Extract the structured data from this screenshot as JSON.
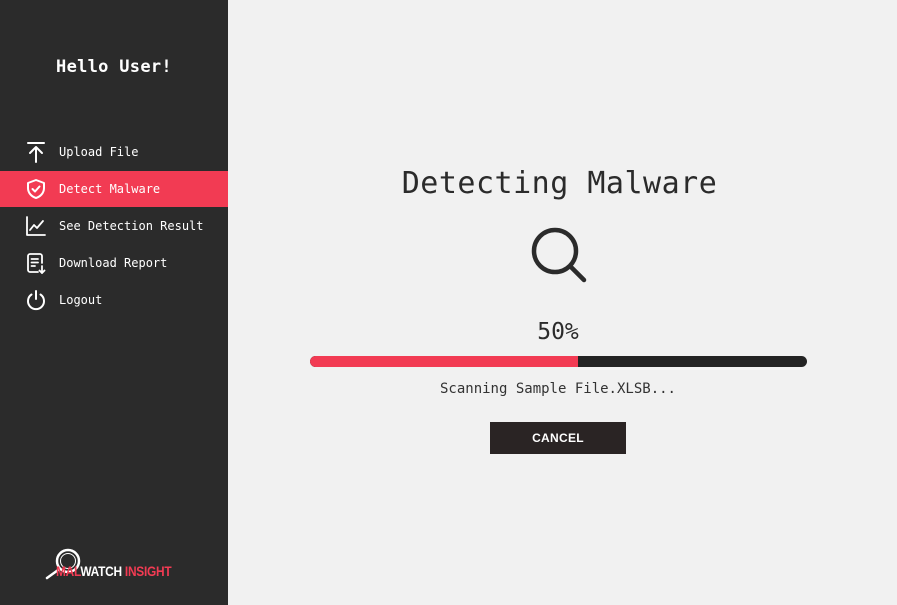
{
  "sidebar": {
    "greeting": "Hello User!",
    "items": [
      {
        "label": "Upload File",
        "icon": "upload-icon",
        "active": false
      },
      {
        "label": "Detect Malware",
        "icon": "shield-check-icon",
        "active": true
      },
      {
        "label": "See Detection Result",
        "icon": "line-chart-icon",
        "active": false
      },
      {
        "label": "Download Report",
        "icon": "report-download-icon",
        "active": false
      },
      {
        "label": "Logout",
        "icon": "power-icon",
        "active": false
      }
    ],
    "logo": {
      "part1": "Mal",
      "part2": "Watch",
      "part3": "Insight",
      "icon": "magnifier-logo-icon"
    }
  },
  "main": {
    "title": "Detecting Malware",
    "icon": "search-icon",
    "progress_text": "50%",
    "progress_value": 0.54,
    "status": "Scanning Sample File.XLSB...",
    "cancel_label": "CANCEL"
  },
  "colors": {
    "sidebar_bg": "#2b2b2b",
    "accent": "#f23b53",
    "background": "#f1f1f1",
    "track": "#232323"
  }
}
